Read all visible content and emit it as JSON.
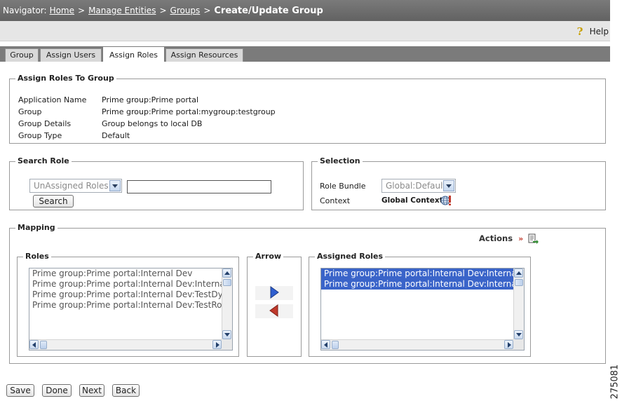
{
  "navigator": {
    "label": "Navigator:",
    "crumbs": [
      "Home",
      "Manage Entities",
      "Groups"
    ],
    "separator": ">",
    "current": "Create/Update Group"
  },
  "help": {
    "label": "Help",
    "icon": "help-icon"
  },
  "tabs": [
    {
      "label": "Group"
    },
    {
      "label": "Assign Users"
    },
    {
      "label": "Assign Roles",
      "active": true
    },
    {
      "label": "Assign Resources"
    }
  ],
  "assign_roles": {
    "legend": "Assign Roles To Group",
    "fields": [
      {
        "label": "Application Name",
        "value": "Prime group:Prime portal"
      },
      {
        "label": "Group",
        "value": "Prime group:Prime portal:mygroup:testgroup"
      },
      {
        "label": "Group Details",
        "value": "Group belongs to local DB"
      },
      {
        "label": "Group Type",
        "value": "Default"
      }
    ]
  },
  "search_role": {
    "legend": "Search Role",
    "filter_selected": "UnAssigned Roles",
    "search_value": "",
    "search_button": "Search"
  },
  "selection": {
    "legend": "Selection",
    "role_bundle_label": "Role Bundle",
    "role_bundle_value": "Global:Default",
    "context_label": "Context",
    "context_value": "Global Context",
    "context_icon": "globe-context-icon"
  },
  "mapping": {
    "legend": "Mapping",
    "actions_label": "Actions",
    "actions_chevron": "»",
    "actions_icon": "export-icon",
    "roles_legend": "Roles",
    "roles": [
      "Prime group:Prime portal:Internal Dev",
      "Prime group:Prime portal:Internal Dev:Internal Dev",
      "Prime group:Prime portal:Internal Dev:TestDynamic",
      "Prime group:Prime portal:Internal Dev:TestRole"
    ],
    "arrow_legend": "Arrow",
    "assigned_legend": "Assigned Roles",
    "assigned_roles": [
      "Prime group:Prime portal:Internal Dev:Internal Dev",
      "Prime group:Prime portal:Internal Dev:Internal Dev"
    ]
  },
  "footer_buttons": [
    "Save",
    "Done",
    "Next",
    "Back"
  ],
  "figure_number": "275081",
  "colors": {
    "nav_bar": "#6e6e6e",
    "tab_strip": "#7b7b7b",
    "selected_row": "#3a64c9",
    "arrow_right": "#2f5fd0",
    "arrow_left": "#c0392b",
    "actions_chevron": "#c0392b"
  }
}
